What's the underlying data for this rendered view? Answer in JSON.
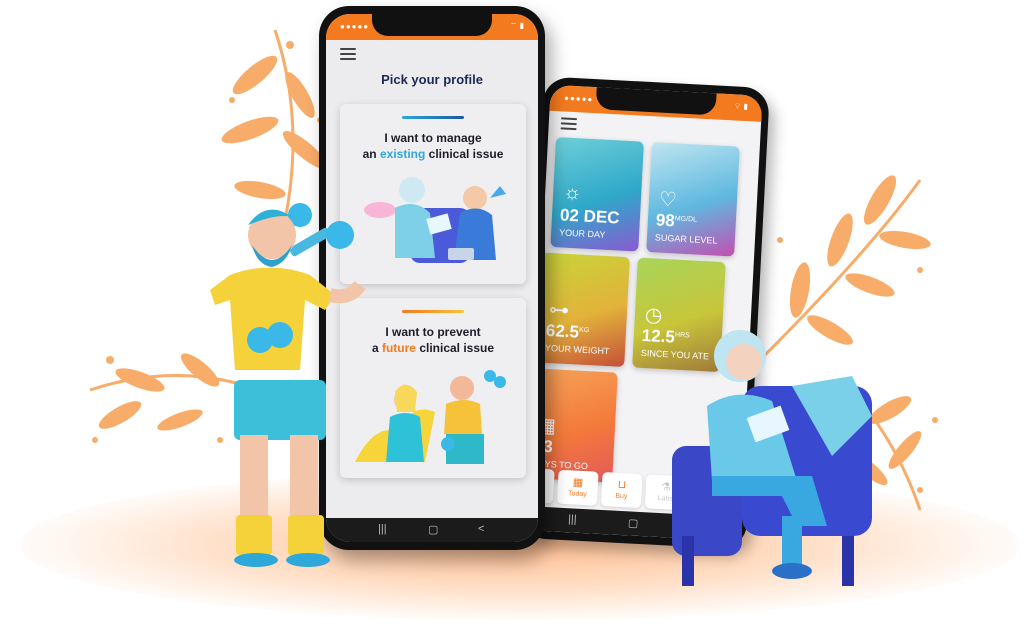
{
  "colors": {
    "accent_orange": "#f47a1f",
    "accent_blue": "#2ea8d9",
    "title_navy": "#1c2a5a"
  },
  "front_phone": {
    "menu_icon": "hamburger-icon",
    "title": "Pick your profile",
    "cards": [
      {
        "line1": "I want to manage",
        "line2_prefix": "an ",
        "line2_highlight": "existing",
        "line2_suffix": " clinical issue"
      },
      {
        "line1": "I want to prevent",
        "line2_prefix": "a ",
        "line2_highlight": "future",
        "line2_suffix": " clinical issue"
      }
    ],
    "nav": {
      "recent": "|||",
      "home": "▢",
      "back": "<"
    }
  },
  "back_phone": {
    "menu_icon": "hamburger-icon",
    "tiles": [
      {
        "icon": "sun-icon",
        "value": "02 DEC",
        "unit": "",
        "label": "YOUR DAY"
      },
      {
        "icon": "heartbeat-icon",
        "value": "98",
        "unit": "MG/DL",
        "label": "SUGAR LEVEL"
      },
      {
        "icon": "dumbbell-icon",
        "value": "62.5",
        "unit": "KG",
        "label": "YOUR WEIGHT"
      },
      {
        "icon": "clock-icon",
        "value": "12.5",
        "unit": "HRS",
        "label": "SINCE YOU ATE"
      },
      {
        "icon": "calendar-icon",
        "value": "03",
        "unit": "",
        "label": "DAYS TO GO"
      }
    ],
    "tabs": [
      {
        "label": "Home",
        "icon": "home-icon",
        "active": true
      },
      {
        "label": "Today",
        "icon": "calendar-icon",
        "active": true
      },
      {
        "label": "Buy",
        "icon": "basket-icon",
        "active": true
      },
      {
        "label": "Labs",
        "icon": "flask-icon",
        "active": false
      }
    ],
    "nav": {
      "recent": "|||",
      "home": "▢",
      "back": "<"
    }
  }
}
